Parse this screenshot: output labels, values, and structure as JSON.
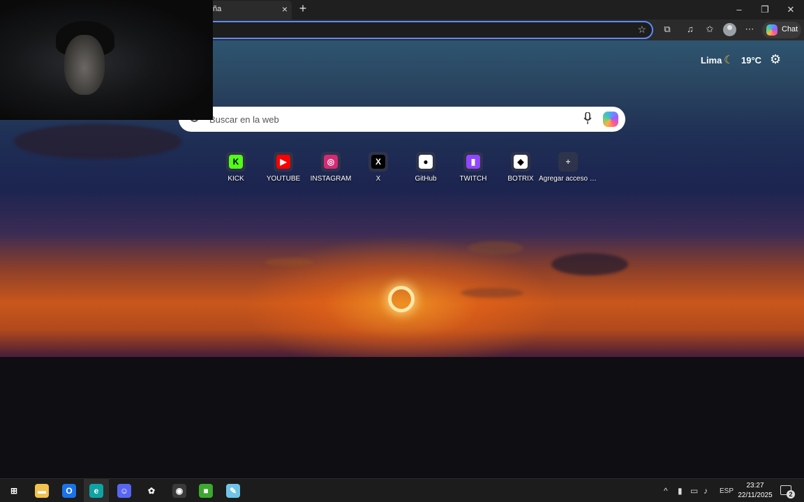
{
  "browser": {
    "tab_title": "ña",
    "window_controls": {
      "minimize": "–",
      "restore": "❐",
      "close": "✕"
    },
    "chat_label": "Chat"
  },
  "weather": {
    "city": "Lima",
    "temperature": "19°C",
    "icon": "moon-icon"
  },
  "search": {
    "placeholder": "Buscar en la web"
  },
  "quick_links": [
    {
      "label": "KICK",
      "glyph": "K",
      "color": "#53fc18",
      "text_color": "#000"
    },
    {
      "label": "YOUTUBE",
      "glyph": "▶",
      "color": "#ff0000",
      "text_color": "#fff"
    },
    {
      "label": "INSTAGRAM",
      "glyph": "◎",
      "color": "#d62976",
      "text_color": "#fff"
    },
    {
      "label": "X",
      "glyph": "X",
      "color": "#000000",
      "text_color": "#fff"
    },
    {
      "label": "GitHub",
      "glyph": "●",
      "color": "#ffffff",
      "text_color": "#000"
    },
    {
      "label": "TWITCH",
      "glyph": "▮",
      "color": "#9146ff",
      "text_color": "#fff"
    },
    {
      "label": "BOTRIX",
      "glyph": "◆",
      "color": "#ffffff",
      "text_color": "#000"
    },
    {
      "label": "Agregar acceso directo",
      "glyph": "+",
      "color": "transparent",
      "text_color": "#ccc"
    }
  ],
  "taskbar": {
    "apps": [
      {
        "name": "windows-start-icon",
        "glyph": "⊞",
        "color": "transparent"
      },
      {
        "name": "file-explorer-icon",
        "glyph": "▬",
        "color": "#f2c14e"
      },
      {
        "name": "outlook-icon",
        "glyph": "O",
        "color": "#1a73e8"
      },
      {
        "name": "edge-icon",
        "glyph": "e",
        "color": "#0fa3a3"
      },
      {
        "name": "discord-icon",
        "glyph": "☺",
        "color": "#5865f2"
      },
      {
        "name": "chatgpt-icon",
        "glyph": "✿",
        "color": "transparent"
      },
      {
        "name": "obs-icon",
        "glyph": "◉",
        "color": "#3a3a3a"
      },
      {
        "name": "minecraft-icon",
        "glyph": "■",
        "color": "#3da82f"
      },
      {
        "name": "notepad-icon",
        "glyph": "✎",
        "color": "#6fc4e8"
      }
    ],
    "language": "ESP",
    "time": "23:27",
    "date": "22/11/2025",
    "notification_count": "2"
  }
}
